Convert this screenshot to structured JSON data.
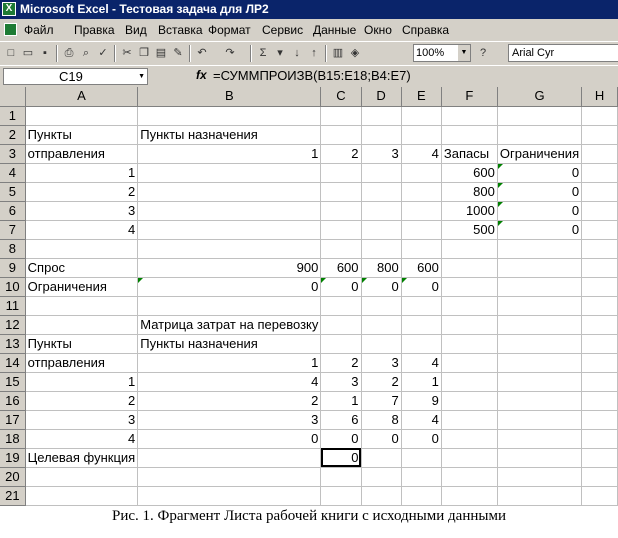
{
  "window": {
    "title": "Microsoft Excel - Тестовая задача для ЛР2"
  },
  "menu": [
    "Файл",
    "Правка",
    "Вид",
    "Вставка",
    "Формат",
    "Сервис",
    "Данные",
    "Окно",
    "Справка"
  ],
  "toolbar": {
    "zoom": "100%",
    "font": "Arial Cyr"
  },
  "formula_bar": {
    "cell_ref": "C19",
    "fx": "fx",
    "formula": "=СУММПРОИЗВ(B15:E18;B4:E7)"
  },
  "columns": [
    "A",
    "B",
    "C",
    "D",
    "E",
    "F",
    "G",
    "H"
  ],
  "rows": [
    {
      "n": "1",
      "cells": [
        "",
        "",
        "",
        "",
        "",
        "",
        "",
        ""
      ]
    },
    {
      "n": "2",
      "cells": [
        "Пункты",
        "Пункты назначения",
        "",
        "",
        "",
        "",
        "",
        ""
      ]
    },
    {
      "n": "3",
      "cells": [
        "отправления",
        "1",
        "2",
        "3",
        "4",
        "Запасы",
        "Ограничения",
        ""
      ]
    },
    {
      "n": "4",
      "cells": [
        "1",
        "",
        "",
        "",
        "",
        "600",
        "0",
        ""
      ]
    },
    {
      "n": "5",
      "cells": [
        "2",
        "",
        "",
        "",
        "",
        "800",
        "0",
        ""
      ]
    },
    {
      "n": "6",
      "cells": [
        "3",
        "",
        "",
        "",
        "",
        "1000",
        "0",
        ""
      ]
    },
    {
      "n": "7",
      "cells": [
        "4",
        "",
        "",
        "",
        "",
        "500",
        "0",
        ""
      ]
    },
    {
      "n": "8",
      "cells": [
        "",
        "",
        "",
        "",
        "",
        "",
        "",
        ""
      ]
    },
    {
      "n": "9",
      "cells": [
        "Спрос",
        "900",
        "600",
        "800",
        "600",
        "",
        "",
        ""
      ]
    },
    {
      "n": "10",
      "cells": [
        "Ограничения",
        "0",
        "0",
        "0",
        "0",
        "",
        "",
        ""
      ]
    },
    {
      "n": "11",
      "cells": [
        "",
        "",
        "",
        "",
        "",
        "",
        "",
        ""
      ]
    },
    {
      "n": "12",
      "cells": [
        "",
        "Матрица затрат на перевозку",
        "",
        "",
        "",
        "",
        "",
        ""
      ]
    },
    {
      "n": "13",
      "cells": [
        "Пункты",
        "Пункты назначения",
        "",
        "",
        "",
        "",
        "",
        ""
      ]
    },
    {
      "n": "14",
      "cells": [
        "отправления",
        "1",
        "2",
        "3",
        "4",
        "",
        "",
        ""
      ]
    },
    {
      "n": "15",
      "cells": [
        "1",
        "4",
        "3",
        "2",
        "1",
        "",
        "",
        ""
      ]
    },
    {
      "n": "16",
      "cells": [
        "2",
        "2",
        "1",
        "7",
        "9",
        "",
        "",
        ""
      ]
    },
    {
      "n": "17",
      "cells": [
        "3",
        "3",
        "6",
        "8",
        "4",
        "",
        "",
        ""
      ]
    },
    {
      "n": "18",
      "cells": [
        "4",
        "0",
        "0",
        "0",
        "0",
        "",
        "",
        ""
      ]
    },
    {
      "n": "19",
      "cells": [
        "Целевая функция",
        "",
        "0",
        "",
        "",
        "",
        "",
        ""
      ]
    },
    {
      "n": "20",
      "cells": [
        "",
        "",
        "",
        "",
        "",
        "",
        "",
        ""
      ]
    },
    {
      "n": "21",
      "cells": [
        "",
        "",
        "",
        "",
        "",
        "",
        "",
        ""
      ]
    }
  ],
  "caption": "Рис. 1. Фрагмент Листа рабочей книги с исходными данными"
}
